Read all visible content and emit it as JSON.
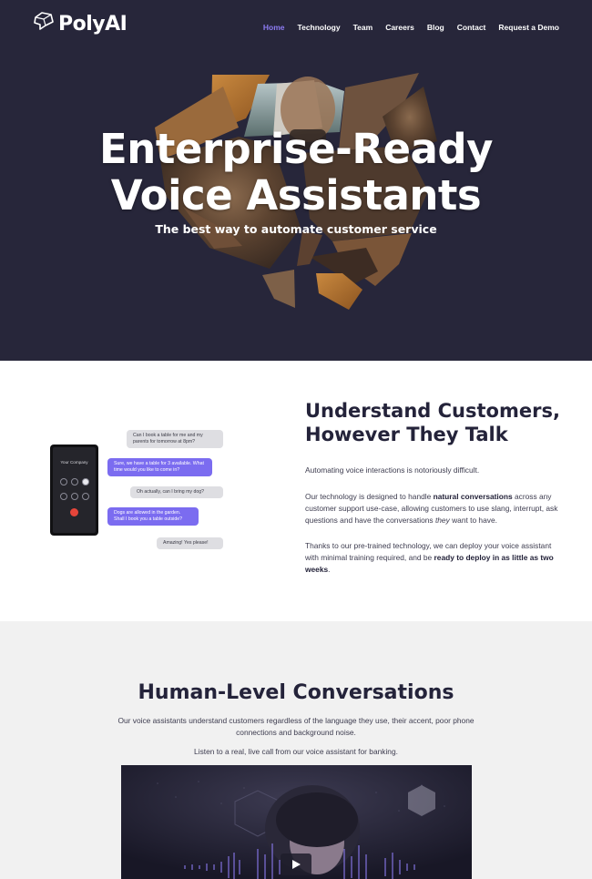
{
  "brand": {
    "name": "PolyAI"
  },
  "nav": {
    "items": [
      {
        "label": "Home",
        "active": true
      },
      {
        "label": "Technology",
        "active": false
      },
      {
        "label": "Team",
        "active": false
      },
      {
        "label": "Careers",
        "active": false
      },
      {
        "label": "Blog",
        "active": false
      },
      {
        "label": "Contact",
        "active": false
      },
      {
        "label": "Request a Demo",
        "active": false
      }
    ]
  },
  "hero": {
    "title_line1": "Enterprise-Ready",
    "title_line2": "Voice Assistants",
    "subtitle": "The best way to automate customer service"
  },
  "understand": {
    "title_line1": "Understand Customers,",
    "title_line2": "However They Talk",
    "p1": "Automating voice interactions is notoriously difficult.",
    "p2_a": "Our technology is designed to handle ",
    "p2_b": "natural conversations",
    "p2_c": " across any customer support use-case, allowing customers to use slang, interrupt, ask questions and have the conversations ",
    "p2_d": "they",
    "p2_e": " want to have.",
    "p3_a": "Thanks to our pre-trained technology, we can deploy your voice assistant with minimal training required, and be ",
    "p3_b": "ready to deploy in as little as two weeks",
    "p3_c": ".",
    "phone": {
      "caller": "Your Company"
    },
    "chat": [
      {
        "from": "customer",
        "text": "Can I book a table for me and my parents for tomorrow at 8pm?"
      },
      {
        "from": "assistant",
        "text": "Sure, we have a table for 3 available. What time would you like to come in?"
      },
      {
        "from": "customer",
        "text": "Oh actually, can I bring my dog?"
      },
      {
        "from": "assistant",
        "text": "Dogs are allowed in the garden. Shall I book you a table outside?"
      },
      {
        "from": "customer",
        "text": "Amazing! Yes please!"
      }
    ]
  },
  "human": {
    "title": "Human-Level Conversations",
    "p1": "Our voice assistants understand customers regardless of the language they use, their accent, poor phone connections and background noise.",
    "p2": "Listen to a real, live call from our voice assistant for banking."
  },
  "colors": {
    "hero_bg": "#27263a",
    "accent": "#7b6cf0",
    "nav_active": "#8d7cf3",
    "section_gray": "#f1f1f1"
  }
}
